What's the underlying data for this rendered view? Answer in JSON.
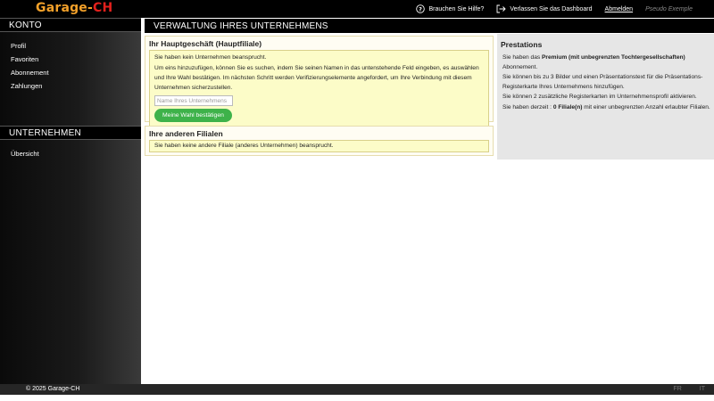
{
  "logo": {
    "part1": "Garage-",
    "part2": "CH"
  },
  "topbar": {
    "help": "Brauchen Sie Hilfe?",
    "leave": "Verlassen Sie das Dashboard",
    "logout": "Abmelden",
    "user": "Pseudo Exemple"
  },
  "sidebar": {
    "konto_title": "KONTO",
    "konto_items": [
      "Profil",
      "Favoriten",
      "Abonnement",
      "Zahlungen"
    ],
    "unternehmen_title": "UNTERNEHMEN",
    "unternehmen_items": [
      "Übersicht"
    ]
  },
  "main": {
    "title": "VERWALTUNG IHRES UNTERNEHMENS",
    "main_business": {
      "title": "Ihr Hauptgeschäft (Hauptfiliale)",
      "notice": "Sie haben kein Unternehmen beansprucht.",
      "instructions": "Um eins hinzuzufügen, können Sie es suchen, indem Sie seinen Namen in das untenstehende Feld eingeben, es auswählen und Ihre Wahl bestätigen. Im nächsten Schritt werden Verifizierungselemente angefordert, um Ihre Verbindung mit diesem Unternehmen sicherzustellen.",
      "input_placeholder": "Name Ihres Unternehmens",
      "input_value": "",
      "confirm_button": "Meine Wahl bestätigen"
    },
    "other_branches": {
      "title": "Ihre anderen Filialen",
      "notice": "Sie haben keine andere Filiale (anderes Unternehmen) beansprucht."
    }
  },
  "prestations": {
    "title": "Prestations",
    "line1_pre": "Sie haben das ",
    "line1_bold": "Premium (mit unbegrenzten Tochtergesellschaften)",
    "line1_post": " Abonnement.",
    "line2": "Sie können bis zu 3 Bilder und einen Präsentationstext für die Präsentations-Registerkarte Ihres Unternehmens hinzufügen.",
    "line3": "Sie können 2 zusätzliche Registerkarten im Unternehmensprofil aktivieren.",
    "line4_pre": "Sie haben derzeit : ",
    "line4_bold": "0 Filiale(n)",
    "line4_post": " mit einer unbegrenzten Anzahl erlaubter Filialen."
  },
  "footer": {
    "copyright": "© 2025 Garage-CH",
    "lang_fr": "FR",
    "lang_it": "IT"
  },
  "colors": {
    "logo_orange": "#f3a12a",
    "logo_red": "#e2201c",
    "button_green": "#3eb24a",
    "notice_yellow": "#fcfcc8"
  }
}
